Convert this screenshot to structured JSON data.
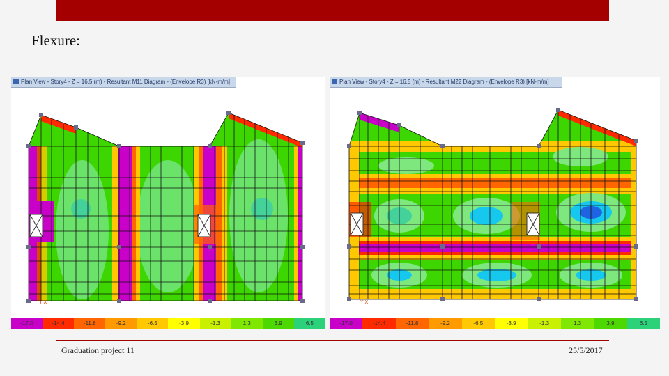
{
  "slide": {
    "title": "Flexure:",
    "footer_left": "Graduation project 11",
    "footer_right": "25/5/2017"
  },
  "colors": {
    "accent": "#a40000",
    "magenta": "#c800c8",
    "red": "#ff2a00",
    "orange": "#ff9b00",
    "yellow": "#ffff00",
    "green": "#4cd800",
    "cyan": "#16c8ee",
    "blue": "#1d63e2"
  },
  "panels": [
    {
      "window_title": "Plan View - Story4 - Z = 16.5 (m) - Resultant M11 Diagram - (Envelope R3) [kN-m/m]",
      "axis_label": "Y  X",
      "legend": {
        "labels": [
          "-17.0",
          "-14.4",
          "-11.8",
          "-9.2",
          "-6.5",
          "-3.9",
          "-1.3",
          "1.3",
          "3.9",
          "6.5"
        ],
        "colors": [
          "#c800c8",
          "#ff2a00",
          "#ff6500",
          "#ff9b00",
          "#ffc800",
          "#ffff00",
          "#c8f000",
          "#80e800",
          "#4cd800",
          "#2cd27a"
        ]
      }
    },
    {
      "window_title": "Plan View - Story4 - Z = 16.5 (m) - Resultant M22 Diagram - (Envelope R3) [kN-m/m]",
      "axis_label": "Y  X",
      "legend": {
        "labels": [
          "-17.0",
          "-14.4",
          "-11.8",
          "-9.2",
          "-6.5",
          "-3.9",
          "-1.3",
          "1.3",
          "3.9",
          "6.5"
        ],
        "colors": [
          "#c800c8",
          "#ff2a00",
          "#ff6500",
          "#ff9b00",
          "#ffc800",
          "#ffff00",
          "#c8f000",
          "#80e800",
          "#4cd800",
          "#2cd27a"
        ]
      }
    }
  ]
}
